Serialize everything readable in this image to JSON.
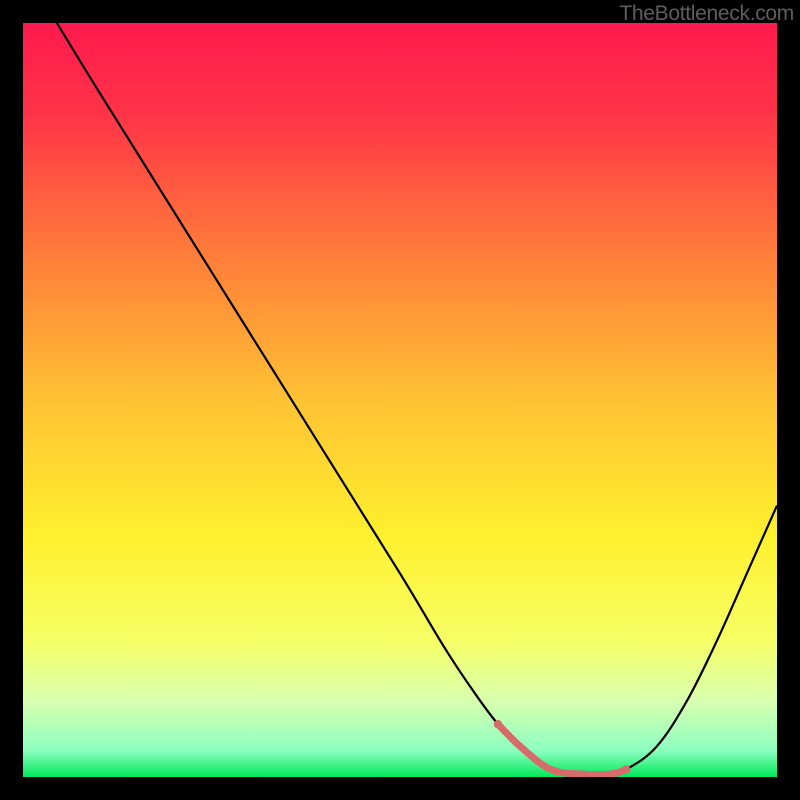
{
  "watermark": "TheBottleneck.com",
  "chart_data": {
    "type": "line",
    "title": "",
    "xlabel": "",
    "ylabel": "",
    "xlim": [
      0,
      100
    ],
    "ylim": [
      0,
      100
    ],
    "background_gradient": {
      "stops": [
        {
          "offset": 0.0,
          "color": "#ff1a4d"
        },
        {
          "offset": 0.12,
          "color": "#ff3348"
        },
        {
          "offset": 0.3,
          "color": "#ff7a3a"
        },
        {
          "offset": 0.5,
          "color": "#ffc233"
        },
        {
          "offset": 0.68,
          "color": "#fff02e"
        },
        {
          "offset": 0.82,
          "color": "#f6ff66"
        },
        {
          "offset": 0.9,
          "color": "#d8ffb0"
        },
        {
          "offset": 0.965,
          "color": "#8cffc0"
        },
        {
          "offset": 1.0,
          "color": "#00e85a"
        }
      ]
    },
    "series": [
      {
        "name": "bottleneck-curve",
        "color": "#000000",
        "stroke_width": 2.2,
        "x": [
          4.5,
          10,
          20,
          30,
          40,
          50,
          56,
          60,
          63,
          66,
          70,
          74,
          78,
          80,
          84,
          88,
          92,
          96,
          100
        ],
        "values": [
          100,
          91,
          75,
          59,
          43,
          27,
          17,
          11,
          7,
          4,
          1,
          0.4,
          0.4,
          1,
          4,
          10,
          18,
          27,
          36
        ]
      }
    ],
    "highlight": {
      "name": "sweet-spot",
      "color": "#d76a6a",
      "stroke_width": 7,
      "cap_radius": 4.2,
      "x": [
        63,
        66,
        70,
        74,
        78,
        80
      ],
      "values": [
        7,
        4,
        1,
        0.4,
        0.4,
        1
      ]
    }
  }
}
